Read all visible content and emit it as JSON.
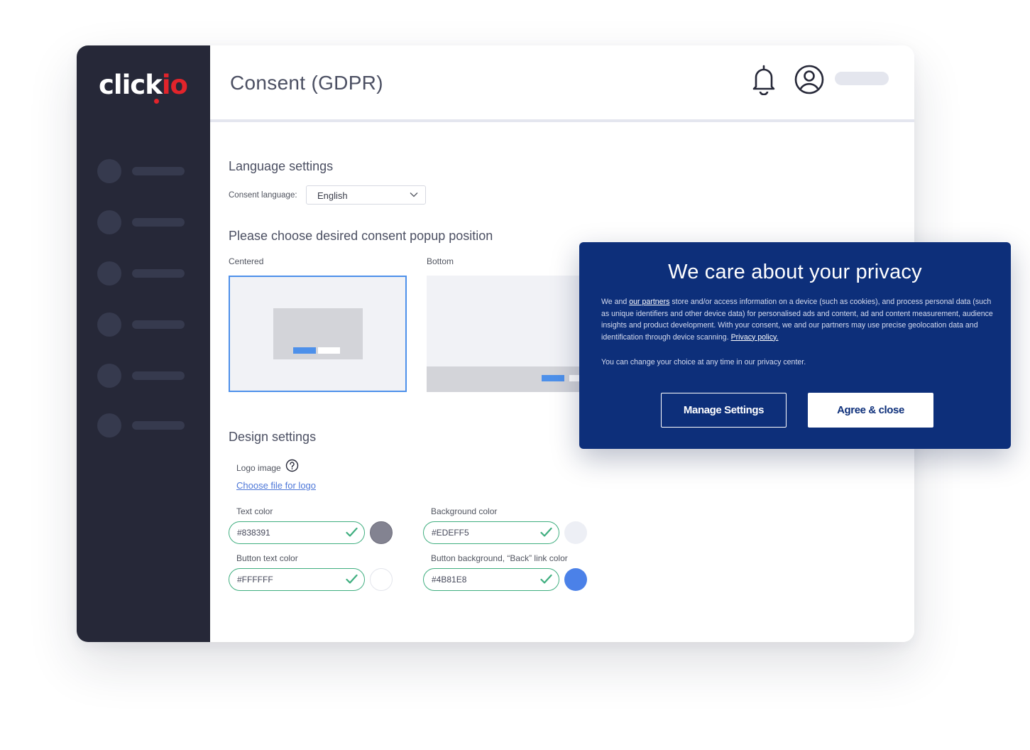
{
  "app": {
    "logo_main": "click",
    "logo_accent": "io"
  },
  "header": {
    "title": "Consent (GDPR)"
  },
  "language_settings": {
    "title": "Language settings",
    "consent_language_label": "Consent language:",
    "consent_language_value": "English"
  },
  "position": {
    "title": "Please choose desired consent popup position",
    "options": [
      {
        "label": "Centered",
        "selected": true
      },
      {
        "label": "Bottom",
        "selected": false
      }
    ]
  },
  "design": {
    "title": "Design settings",
    "logo_label": "Logo image",
    "logo_link": "Choose file for logo",
    "fields": [
      {
        "label": "Text color",
        "value": "#838391",
        "color": "#838391"
      },
      {
        "label": "Background color",
        "value": "#EDEFF5",
        "color": "#EDEFF5"
      },
      {
        "label": "Button text color",
        "value": "#FFFFFF",
        "color": "#FFFFFF"
      },
      {
        "label": "Button background, “Back” link color",
        "value": "#4B81E8",
        "color": "#4B81E8"
      }
    ]
  },
  "popup": {
    "title": "We care about your privacy",
    "body_prefix": "We and ",
    "partners_link": "our partners",
    "body_main": " store and/or access information on a device (such as cookies), and process personal data (such as unique identifiers and other device data) for personalised ads and content, ad and content measurement, audience insights and product development. With your consent, we and our partners may use precise geolocation data and identification through device scanning. ",
    "privacy_link": "Privacy policy.",
    "note": "You can change your choice at any time in our privacy center.",
    "manage_label": "Manage Settings",
    "agree_label": "Agree & close"
  },
  "colors": {
    "sidebar": "#262838",
    "accent": "#e2242b",
    "popup_bg": "#0d2f7a",
    "selected_border": "#4d90ea",
    "valid_green": "#3fae7f"
  },
  "icons": [
    "bell-icon",
    "account-icon",
    "chevron-down-icon",
    "help-icon",
    "check-icon"
  ]
}
